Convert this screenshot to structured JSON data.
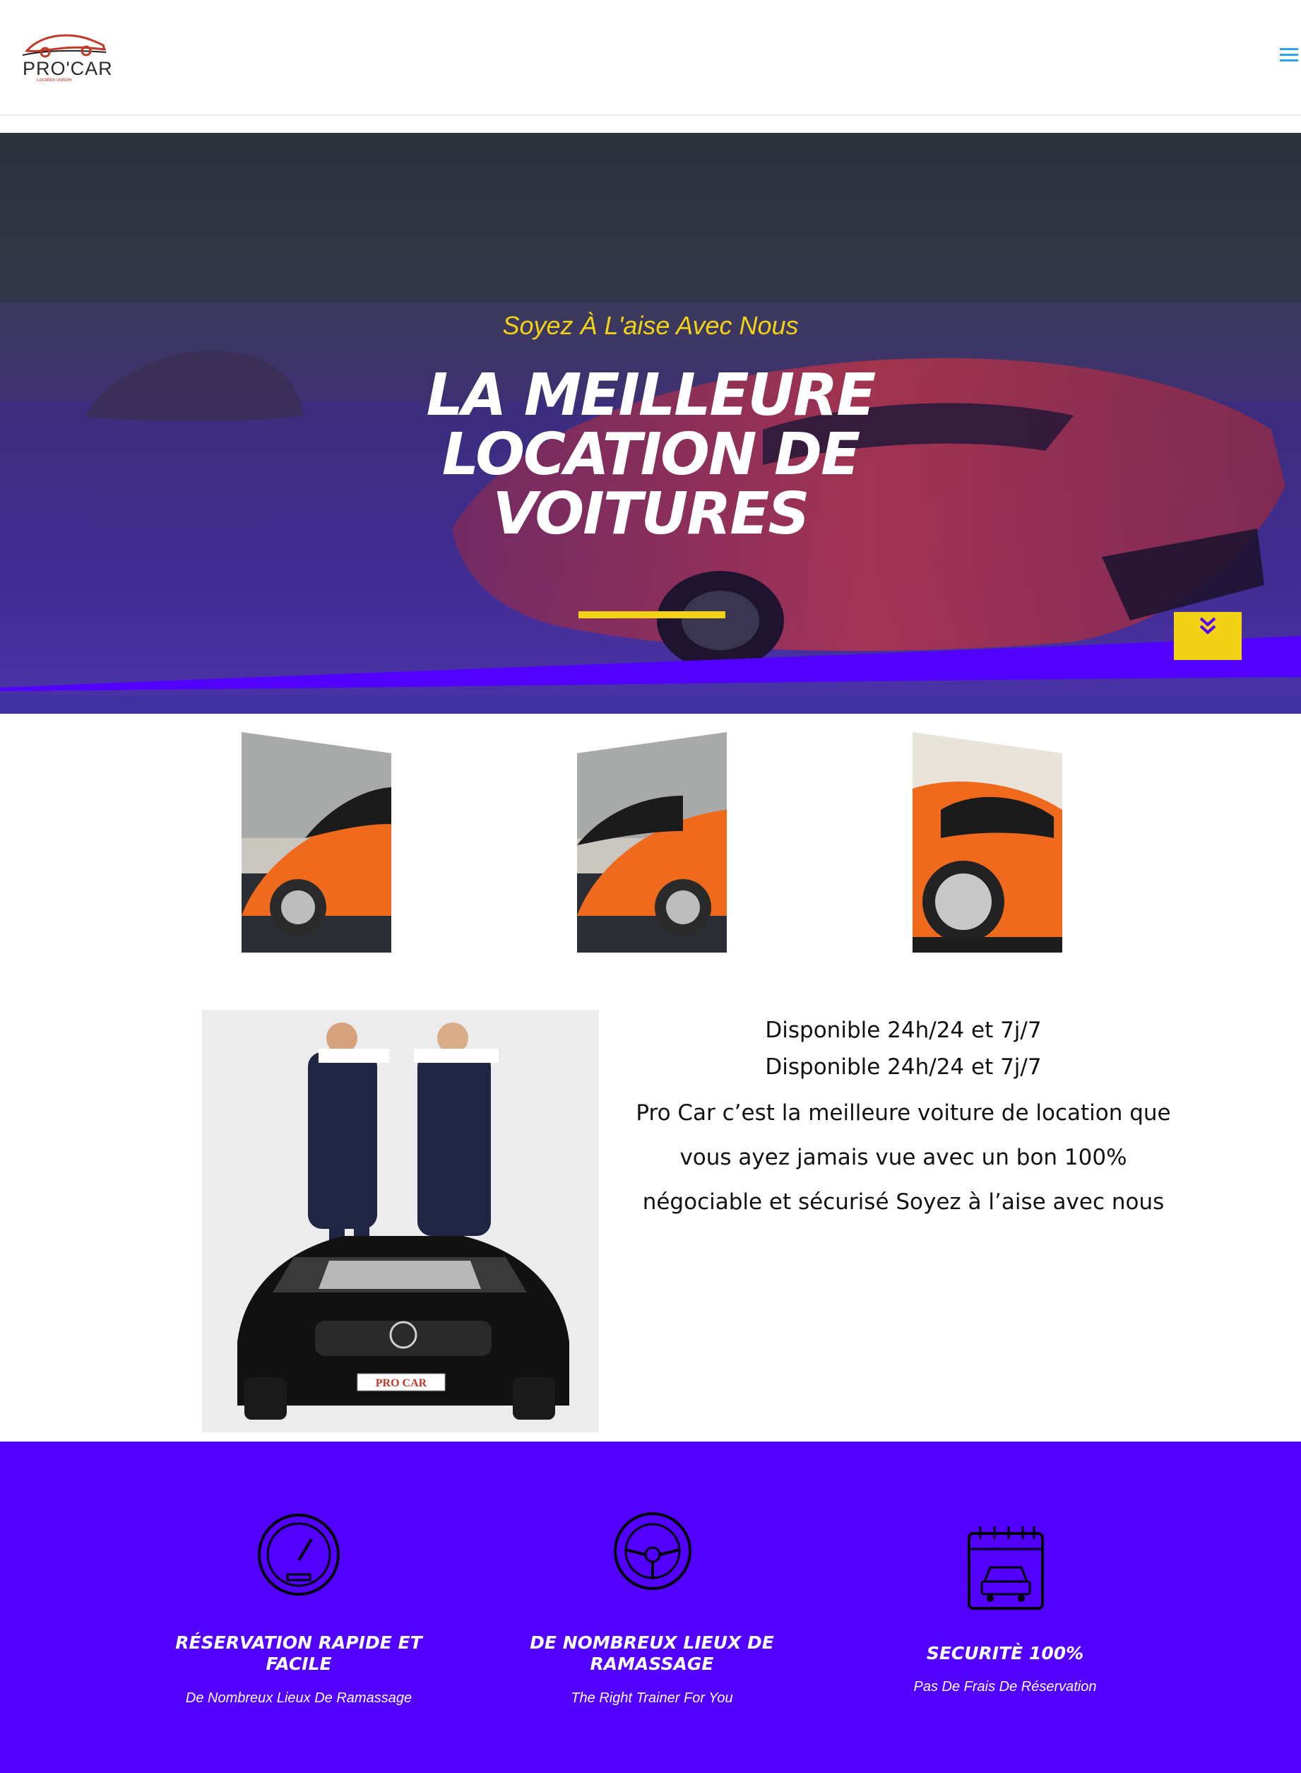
{
  "header": {
    "logo_text": "PRO'CAR",
    "logo_sub": "Location voiture",
    "menu_icon": "hamburger-menu-icon"
  },
  "hero": {
    "subtitle": "Soyez À L'aise Avec Nous",
    "title": "LA MEILLEURE LOCATION DE VOITURES",
    "scroll_icon": "double-chevron-down-icon"
  },
  "gallery": {
    "items": [
      "orange-sports-car",
      "orange-sports-car",
      "orange-sports-car-rear"
    ]
  },
  "about": {
    "image": "mechanics-with-black-car",
    "plate_text": "PRO CAR",
    "line1": "Disponible 24h/24 et 7j/7",
    "line2": "Disponible 24h/24 et 7j/7",
    "body": "Pro Car c’est la meilleure voiture de location que vous ayez jamais vue avec un bon 100% négociable et sécurisé Soyez à l’aise avec nous"
  },
  "features": [
    {
      "icon": "speedometer-icon",
      "title": "RÉSERVATION RAPIDE ET FACILE",
      "text": "De Nombreux Lieux De Ramassage"
    },
    {
      "icon": "steering-wheel-icon",
      "title": "DE NOMBREUX LIEUX DE RAMASSAGE",
      "text": "The Right Trainer For You"
    },
    {
      "icon": "calendar-car-icon",
      "title": "SECURITÈ 100%",
      "text": "Pas De Frais De Réservation"
    }
  ],
  "colors": {
    "accent": "#5200ff",
    "yellow": "#f2d214",
    "link": "#2ea3f2"
  }
}
